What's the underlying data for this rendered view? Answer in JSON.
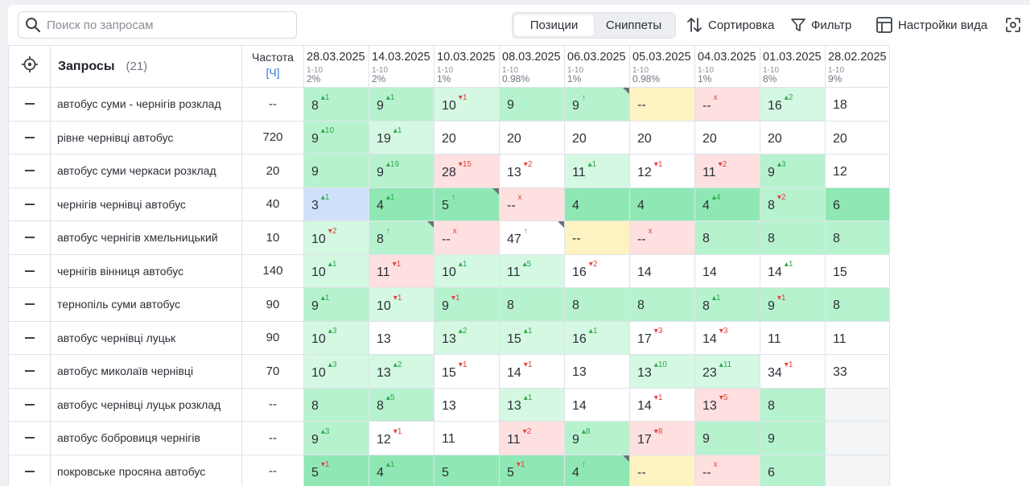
{
  "toolbar": {
    "search_placeholder": "Поиск по запросам",
    "tab_positions": "Позиции",
    "tab_snippets": "Сниппеты",
    "sort_label": "Сортировка",
    "filter_label": "Фильтр",
    "view_settings_label": "Настройки вида"
  },
  "colors": {
    "green": "#b7f2cf",
    "light_green": "#d4f8e2",
    "dark_green": "#8fe8b4",
    "red": "#fde0df",
    "yellow": "#fdf3c2",
    "blue": "#cfe0fb",
    "empty": "#f4f5f7",
    "up": "#2aa84a",
    "down": "#e0433e",
    "link": "#2f7bd8"
  },
  "table": {
    "query_header": "Запросы",
    "query_count": "(21)",
    "freq_header": "Частота",
    "freq_mode": "[Ч]",
    "dates": [
      {
        "date": "28.03.2025",
        "range": "1-10",
        "pct": "2%"
      },
      {
        "date": "14.03.2025",
        "range": "1-10",
        "pct": "2%"
      },
      {
        "date": "10.03.2025",
        "range": "1-10",
        "pct": "1%"
      },
      {
        "date": "08.03.2025",
        "range": "1-10",
        "pct": "0.98%"
      },
      {
        "date": "06.03.2025",
        "range": "1-10",
        "pct": "1%"
      },
      {
        "date": "05.03.2025",
        "range": "1-10",
        "pct": "0.98%"
      },
      {
        "date": "04.03.2025",
        "range": "1-10",
        "pct": "1%"
      },
      {
        "date": "01.03.2025",
        "range": "1-10",
        "pct": "8%"
      },
      {
        "date": "28.02.2025",
        "range": "1-10",
        "pct": "9%"
      }
    ],
    "rows": [
      {
        "query": "автобус суми - чернігів розклад",
        "freq": "--",
        "cells": [
          {
            "v": "8",
            "d": "▴1",
            "t": "up",
            "bg": "g"
          },
          {
            "v": "9",
            "d": "▴1",
            "t": "up",
            "bg": "g"
          },
          {
            "v": "10",
            "d": "▾1",
            "t": "dn",
            "bg": "lg"
          },
          {
            "v": "9",
            "d": "",
            "t": "",
            "bg": "g"
          },
          {
            "v": "9",
            "d": "↑",
            "t": "up",
            "bg": "g",
            "tri": true
          },
          {
            "v": "--",
            "d": "",
            "t": "",
            "bg": "y"
          },
          {
            "v": "--",
            "d": "x",
            "t": "dn",
            "bg": "r"
          },
          {
            "v": "16",
            "d": "▴2",
            "t": "up",
            "bg": "lg"
          },
          {
            "v": "18",
            "d": "",
            "t": "",
            "bg": "w"
          }
        ]
      },
      {
        "query": "рівне чернівці автобус",
        "freq": "720",
        "cells": [
          {
            "v": "9",
            "d": "▴10",
            "t": "up",
            "bg": "g"
          },
          {
            "v": "19",
            "d": "▴1",
            "t": "up",
            "bg": "lg"
          },
          {
            "v": "20",
            "d": "",
            "t": "",
            "bg": "w"
          },
          {
            "v": "20",
            "d": "",
            "t": "",
            "bg": "w"
          },
          {
            "v": "20",
            "d": "",
            "t": "",
            "bg": "w"
          },
          {
            "v": "20",
            "d": "",
            "t": "",
            "bg": "w"
          },
          {
            "v": "20",
            "d": "",
            "t": "",
            "bg": "w"
          },
          {
            "v": "20",
            "d": "",
            "t": "",
            "bg": "w"
          },
          {
            "v": "20",
            "d": "",
            "t": "",
            "bg": "w"
          }
        ]
      },
      {
        "query": "автобус суми черкаси розклад",
        "freq": "20",
        "cells": [
          {
            "v": "9",
            "d": "",
            "t": "",
            "bg": "g"
          },
          {
            "v": "9",
            "d": "▴19",
            "t": "up",
            "bg": "g"
          },
          {
            "v": "28",
            "d": "▾15",
            "t": "dn",
            "bg": "r"
          },
          {
            "v": "13",
            "d": "▾2",
            "t": "dn",
            "bg": "w"
          },
          {
            "v": "11",
            "d": "▴1",
            "t": "up",
            "bg": "lg"
          },
          {
            "v": "12",
            "d": "▾1",
            "t": "dn",
            "bg": "w"
          },
          {
            "v": "11",
            "d": "▾2",
            "t": "dn",
            "bg": "r"
          },
          {
            "v": "9",
            "d": "▴3",
            "t": "up",
            "bg": "g"
          },
          {
            "v": "12",
            "d": "",
            "t": "",
            "bg": "w"
          }
        ]
      },
      {
        "query": "чернігів чернівці автобус",
        "freq": "40",
        "cells": [
          {
            "v": "3",
            "d": "▴1",
            "t": "up",
            "bg": "b"
          },
          {
            "v": "4",
            "d": "▴1",
            "t": "up",
            "bg": "dg"
          },
          {
            "v": "5",
            "d": "↑",
            "t": "up",
            "bg": "dg",
            "tri": true
          },
          {
            "v": "--",
            "d": "x",
            "t": "dn",
            "bg": "r"
          },
          {
            "v": "4",
            "d": "",
            "t": "",
            "bg": "dg"
          },
          {
            "v": "4",
            "d": "",
            "t": "",
            "bg": "dg"
          },
          {
            "v": "4",
            "d": "▴4",
            "t": "up",
            "bg": "dg"
          },
          {
            "v": "8",
            "d": "▾2",
            "t": "dn",
            "bg": "g"
          },
          {
            "v": "6",
            "d": "",
            "t": "",
            "bg": "dg"
          }
        ]
      },
      {
        "query": "автобус чернігів хмельницький",
        "freq": "10",
        "cells": [
          {
            "v": "10",
            "d": "▾2",
            "t": "dn",
            "bg": "lg"
          },
          {
            "v": "8",
            "d": "↑",
            "t": "up",
            "bg": "g",
            "tri": true
          },
          {
            "v": "--",
            "d": "x",
            "t": "dn",
            "bg": "r"
          },
          {
            "v": "47",
            "d": "↑",
            "t": "up",
            "bg": "w",
            "tri": true
          },
          {
            "v": "--",
            "d": "",
            "t": "",
            "bg": "y"
          },
          {
            "v": "--",
            "d": "x",
            "t": "dn",
            "bg": "r"
          },
          {
            "v": "8",
            "d": "",
            "t": "",
            "bg": "g"
          },
          {
            "v": "8",
            "d": "",
            "t": "",
            "bg": "g"
          },
          {
            "v": "8",
            "d": "",
            "t": "",
            "bg": "g"
          }
        ]
      },
      {
        "query": "чернігів вінниця автобус",
        "freq": "140",
        "cells": [
          {
            "v": "10",
            "d": "▴1",
            "t": "up",
            "bg": "lg"
          },
          {
            "v": "11",
            "d": "▾1",
            "t": "dn",
            "bg": "r"
          },
          {
            "v": "10",
            "d": "▴1",
            "t": "up",
            "bg": "lg"
          },
          {
            "v": "11",
            "d": "▴5",
            "t": "up",
            "bg": "lg"
          },
          {
            "v": "16",
            "d": "▾2",
            "t": "dn",
            "bg": "w"
          },
          {
            "v": "14",
            "d": "",
            "t": "",
            "bg": "w"
          },
          {
            "v": "14",
            "d": "",
            "t": "",
            "bg": "w"
          },
          {
            "v": "14",
            "d": "▴1",
            "t": "up",
            "bg": "w"
          },
          {
            "v": "15",
            "d": "",
            "t": "",
            "bg": "w"
          }
        ]
      },
      {
        "query": "тернопіль суми автобус",
        "freq": "90",
        "cells": [
          {
            "v": "9",
            "d": "▴1",
            "t": "up",
            "bg": "g"
          },
          {
            "v": "10",
            "d": "▾1",
            "t": "dn",
            "bg": "lg"
          },
          {
            "v": "9",
            "d": "▾1",
            "t": "dn",
            "bg": "g"
          },
          {
            "v": "8",
            "d": "",
            "t": "",
            "bg": "g"
          },
          {
            "v": "8",
            "d": "",
            "t": "",
            "bg": "g"
          },
          {
            "v": "8",
            "d": "",
            "t": "",
            "bg": "g"
          },
          {
            "v": "8",
            "d": "▴1",
            "t": "up",
            "bg": "g"
          },
          {
            "v": "9",
            "d": "▾1",
            "t": "dn",
            "bg": "g"
          },
          {
            "v": "8",
            "d": "",
            "t": "",
            "bg": "g"
          }
        ]
      },
      {
        "query": "автобус чернівці луцьк",
        "freq": "90",
        "cells": [
          {
            "v": "10",
            "d": "▴3",
            "t": "up",
            "bg": "lg"
          },
          {
            "v": "13",
            "d": "",
            "t": "",
            "bg": "w"
          },
          {
            "v": "13",
            "d": "▴2",
            "t": "up",
            "bg": "lg"
          },
          {
            "v": "15",
            "d": "▴1",
            "t": "up",
            "bg": "lg"
          },
          {
            "v": "16",
            "d": "▴1",
            "t": "up",
            "bg": "lg"
          },
          {
            "v": "17",
            "d": "▾3",
            "t": "dn",
            "bg": "w"
          },
          {
            "v": "14",
            "d": "▾3",
            "t": "dn",
            "bg": "w"
          },
          {
            "v": "11",
            "d": "",
            "t": "",
            "bg": "w"
          },
          {
            "v": "11",
            "d": "",
            "t": "",
            "bg": "w"
          }
        ]
      },
      {
        "query": "автобус миколаїв чернівці",
        "freq": "70",
        "cells": [
          {
            "v": "10",
            "d": "▴3",
            "t": "up",
            "bg": "lg"
          },
          {
            "v": "13",
            "d": "▴2",
            "t": "up",
            "bg": "lg"
          },
          {
            "v": "15",
            "d": "▾1",
            "t": "dn",
            "bg": "w"
          },
          {
            "v": "14",
            "d": "▾1",
            "t": "dn",
            "bg": "w"
          },
          {
            "v": "13",
            "d": "",
            "t": "",
            "bg": "w"
          },
          {
            "v": "13",
            "d": "▴10",
            "t": "up",
            "bg": "lg"
          },
          {
            "v": "23",
            "d": "▴11",
            "t": "up",
            "bg": "lg"
          },
          {
            "v": "34",
            "d": "▾1",
            "t": "dn",
            "bg": "w"
          },
          {
            "v": "33",
            "d": "",
            "t": "",
            "bg": "w"
          }
        ]
      },
      {
        "query": "автобус чернівці луцьк розклад",
        "freq": "--",
        "cells": [
          {
            "v": "8",
            "d": "",
            "t": "",
            "bg": "g"
          },
          {
            "v": "8",
            "d": "▴5",
            "t": "up",
            "bg": "g"
          },
          {
            "v": "13",
            "d": "",
            "t": "",
            "bg": "w"
          },
          {
            "v": "13",
            "d": "▴1",
            "t": "up",
            "bg": "lg"
          },
          {
            "v": "14",
            "d": "",
            "t": "",
            "bg": "w"
          },
          {
            "v": "14",
            "d": "▾1",
            "t": "dn",
            "bg": "w"
          },
          {
            "v": "13",
            "d": "▾5",
            "t": "dn",
            "bg": "r"
          },
          {
            "v": "8",
            "d": "",
            "t": "",
            "bg": "g"
          },
          {
            "v": "",
            "d": "",
            "t": "",
            "bg": "e"
          }
        ]
      },
      {
        "query": "автобус бобровиця чернігів",
        "freq": "--",
        "cells": [
          {
            "v": "9",
            "d": "▴3",
            "t": "up",
            "bg": "g"
          },
          {
            "v": "12",
            "d": "▾1",
            "t": "dn",
            "bg": "w"
          },
          {
            "v": "11",
            "d": "",
            "t": "",
            "bg": "w"
          },
          {
            "v": "11",
            "d": "▾2",
            "t": "dn",
            "bg": "r"
          },
          {
            "v": "9",
            "d": "▴8",
            "t": "up",
            "bg": "g"
          },
          {
            "v": "17",
            "d": "▾8",
            "t": "dn",
            "bg": "r"
          },
          {
            "v": "9",
            "d": "",
            "t": "",
            "bg": "g"
          },
          {
            "v": "9",
            "d": "",
            "t": "",
            "bg": "g"
          },
          {
            "v": "",
            "d": "",
            "t": "",
            "bg": "e"
          }
        ]
      },
      {
        "query": "покровське просяна автобус",
        "freq": "--",
        "cells": [
          {
            "v": "5",
            "d": "▾1",
            "t": "dn",
            "bg": "dg"
          },
          {
            "v": "4",
            "d": "▴1",
            "t": "up",
            "bg": "dg"
          },
          {
            "v": "5",
            "d": "",
            "t": "",
            "bg": "dg"
          },
          {
            "v": "5",
            "d": "▾1",
            "t": "dn",
            "bg": "dg"
          },
          {
            "v": "4",
            "d": "↑",
            "t": "up",
            "bg": "dg",
            "tri": true
          },
          {
            "v": "--",
            "d": "",
            "t": "",
            "bg": "y"
          },
          {
            "v": "--",
            "d": "x",
            "t": "dn",
            "bg": "r"
          },
          {
            "v": "6",
            "d": "",
            "t": "",
            "bg": "g"
          },
          {
            "v": "",
            "d": "",
            "t": "",
            "bg": "e"
          }
        ]
      }
    ]
  }
}
